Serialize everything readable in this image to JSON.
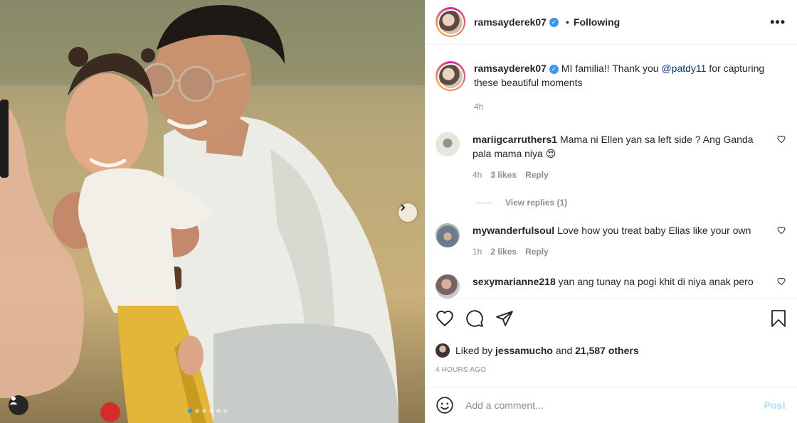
{
  "post": {
    "username": "ramsayderek07",
    "follow_status": "Following",
    "more_label": "•••",
    "separator": "•"
  },
  "caption": {
    "username": "ramsayderek07",
    "text_before": "MI familia!! Thank you ",
    "mention": "@patdy11",
    "text_after": " for capturing these beautiful moments",
    "time": "4h"
  },
  "comments": [
    {
      "username": "mariigcarruthers1",
      "text": "Mama ni Ellen yan sa left side ? Ang Ganda pala mama niya 😍",
      "time": "4h",
      "likes": "3 likes",
      "reply_label": "Reply",
      "avatar_color": "#c9cfc3"
    },
    {
      "username": "mywanderfulsoul",
      "text": "Love how you treat baby Elias like your own",
      "time": "1h",
      "likes": "2 likes",
      "reply_label": "Reply",
      "avatar_color": "#7e8aa0"
    },
    {
      "username": "sexymarianne218",
      "text": "yan ang tunay na pogi khit di niya anak pero",
      "time": "",
      "likes": "",
      "reply_label": "",
      "avatar_color": "#a78b80"
    }
  ],
  "view_replies": "View replies (1)",
  "likes_summary": {
    "prefix": "Liked by ",
    "user": "jessamucho",
    "middle": " and ",
    "count": "21,587 others"
  },
  "timestamp": "4 HOURS AGO",
  "add_comment": {
    "placeholder": "Add a comment...",
    "post_label": "Post"
  },
  "carousel": {
    "total": 6,
    "active": 1
  },
  "colors": {
    "verified": "#3897f0",
    "mention": "#00376b",
    "post_disabled": "#b2dffc",
    "active_dot": "#1e9bf0"
  }
}
